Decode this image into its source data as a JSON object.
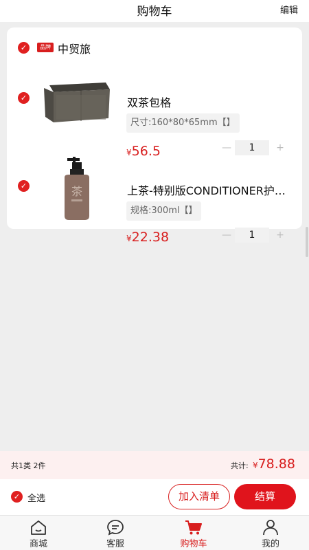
{
  "header": {
    "title": "购物车",
    "edit_label": "编辑"
  },
  "shop": {
    "badge": "品牌",
    "name": "中贸旅",
    "checked": true
  },
  "items": [
    {
      "name": "双茶包格",
      "spec": "尺寸:160*80*65mm【】",
      "currency": "¥",
      "price": "56.5",
      "quantity": "1",
      "checked": true,
      "image_icon": "tea-box-image"
    },
    {
      "name": "上茶-特别版CONDITIONER护发素",
      "spec": "规格:300ml【】",
      "currency": "¥",
      "price": "22.38",
      "quantity": "1",
      "checked": true,
      "image_icon": "pump-bottle-image"
    }
  ],
  "stepper": {
    "minus": "—",
    "plus": "+"
  },
  "summary": {
    "count_text": "共1类  2件",
    "total_label": "共计:",
    "currency": "¥",
    "total": "78.88"
  },
  "actions": {
    "select_all_label": "全选",
    "add_to_list_label": "加入清单",
    "checkout_label": "结算"
  },
  "tabbar": {
    "tabs": [
      {
        "label": "商城",
        "icon": "home-icon"
      },
      {
        "label": "客服",
        "icon": "chat-icon"
      },
      {
        "label": "购物车",
        "icon": "cart-icon",
        "active": true
      },
      {
        "label": "我的",
        "icon": "user-icon"
      }
    ]
  },
  "colors": {
    "accent": "#d81e1e",
    "background": "#eeeeee"
  }
}
